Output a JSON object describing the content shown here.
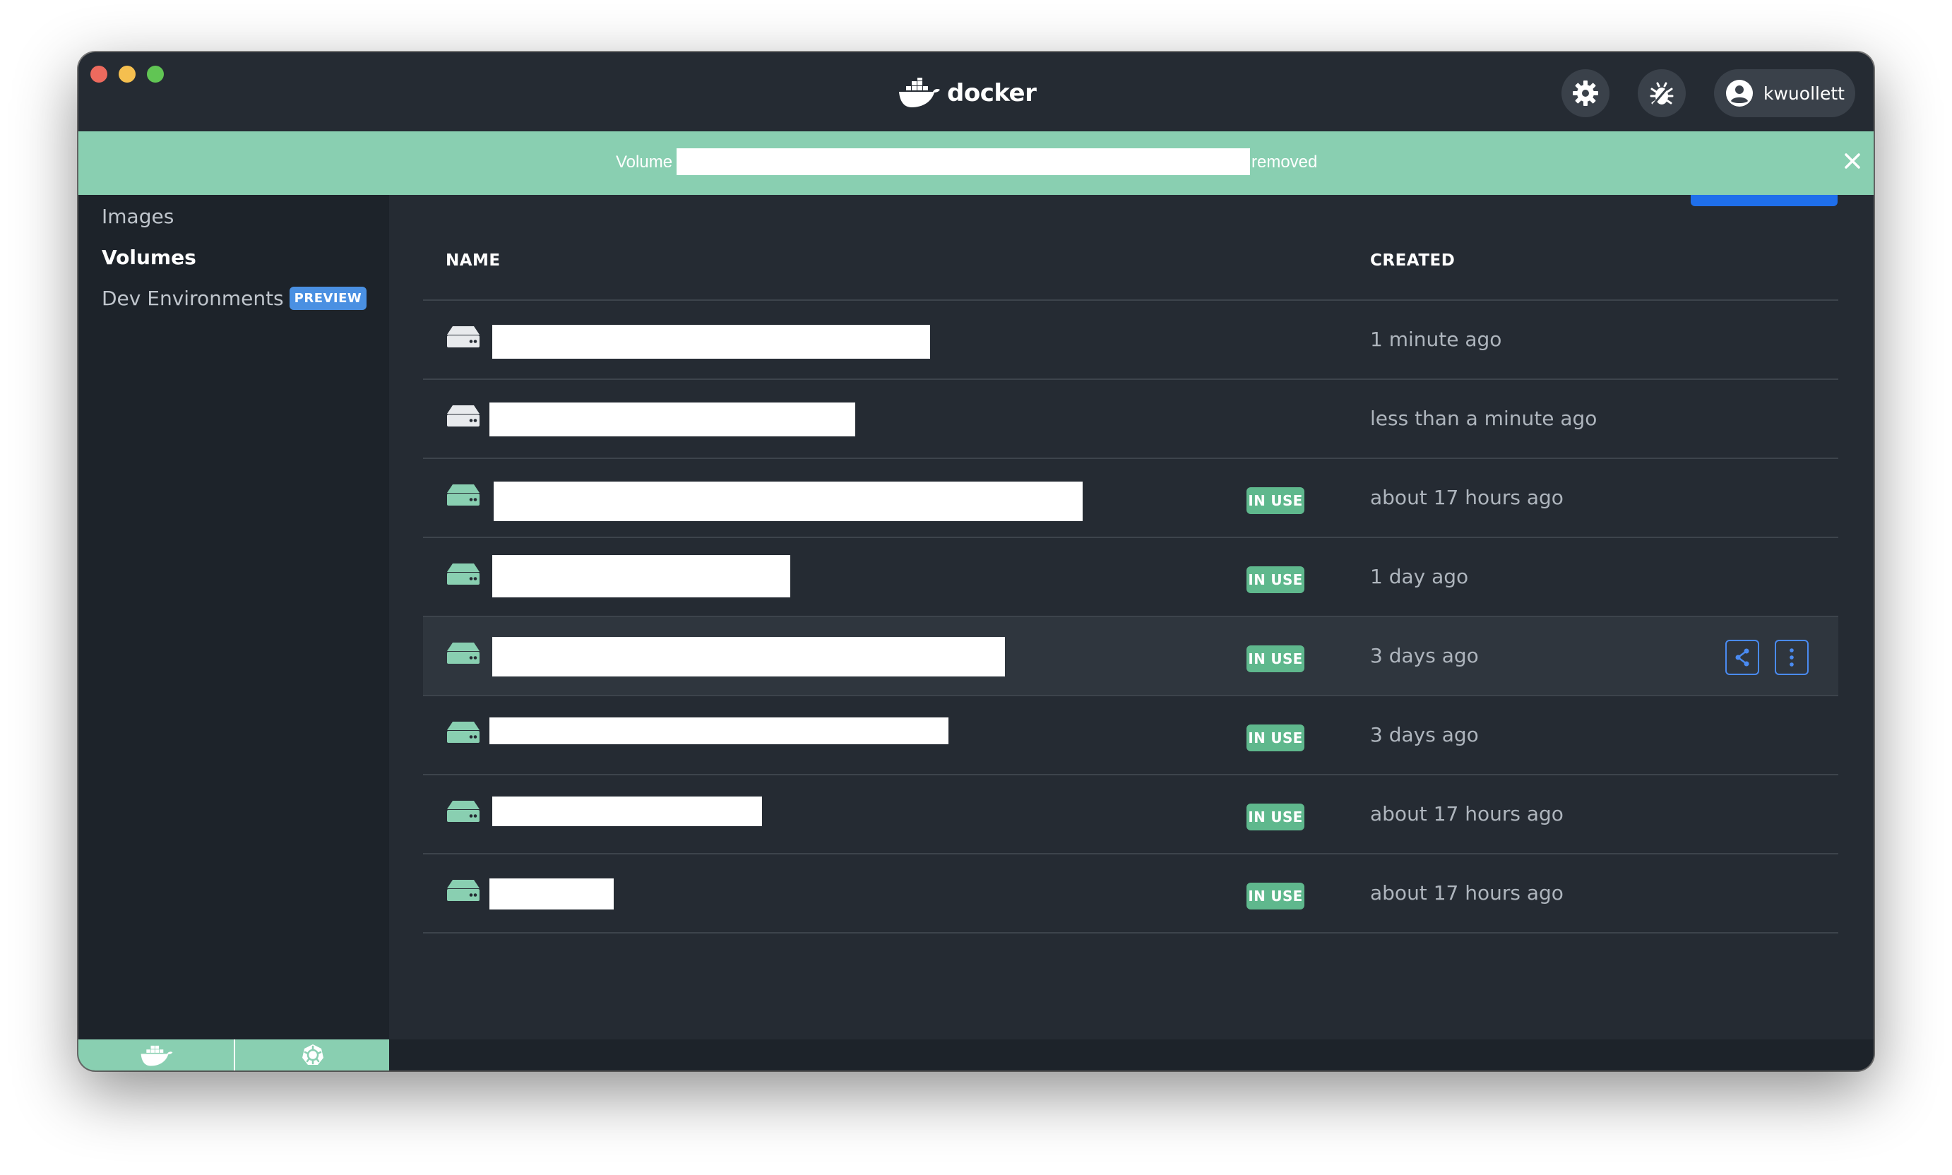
{
  "app": {
    "brand": "docker",
    "user": "kwuollett"
  },
  "banner": {
    "prefix": "Volume",
    "suffix": "removed"
  },
  "sidebar": {
    "items": [
      {
        "label": "Images"
      },
      {
        "label": "Volumes"
      },
      {
        "label": "Dev Environments",
        "badge": "PREVIEW"
      }
    ]
  },
  "table": {
    "columns": {
      "name": "NAME",
      "created": "CREATED"
    },
    "rows": [
      {
        "created": "1 minute ago",
        "status": ""
      },
      {
        "created": "less than a minute ago",
        "status": ""
      },
      {
        "created": "about 17 hours ago",
        "status": "IN USE"
      },
      {
        "created": "1 day ago",
        "status": "IN USE"
      },
      {
        "created": "3 days ago",
        "status": "IN USE"
      },
      {
        "created": "3 days ago",
        "status": "IN USE"
      },
      {
        "created": "about 17 hours ago",
        "status": "IN USE"
      },
      {
        "created": "about 17 hours ago",
        "status": "IN USE"
      }
    ]
  },
  "colors": {
    "accent_green": "#89cfb1",
    "in_use_badge": "#5fb88d",
    "primary_blue": "#1f6feb",
    "background": "#252b33",
    "sidebar": "#1d232a"
  },
  "icons": {
    "settings": "gear-icon",
    "troubleshoot": "bug-icon",
    "user": "user-icon",
    "close": "close-icon",
    "volume": "volume-icon",
    "share": "share-icon",
    "more": "more-vertical-icon",
    "engine": "docker-whale-icon",
    "kubernetes": "kubernetes-icon"
  }
}
